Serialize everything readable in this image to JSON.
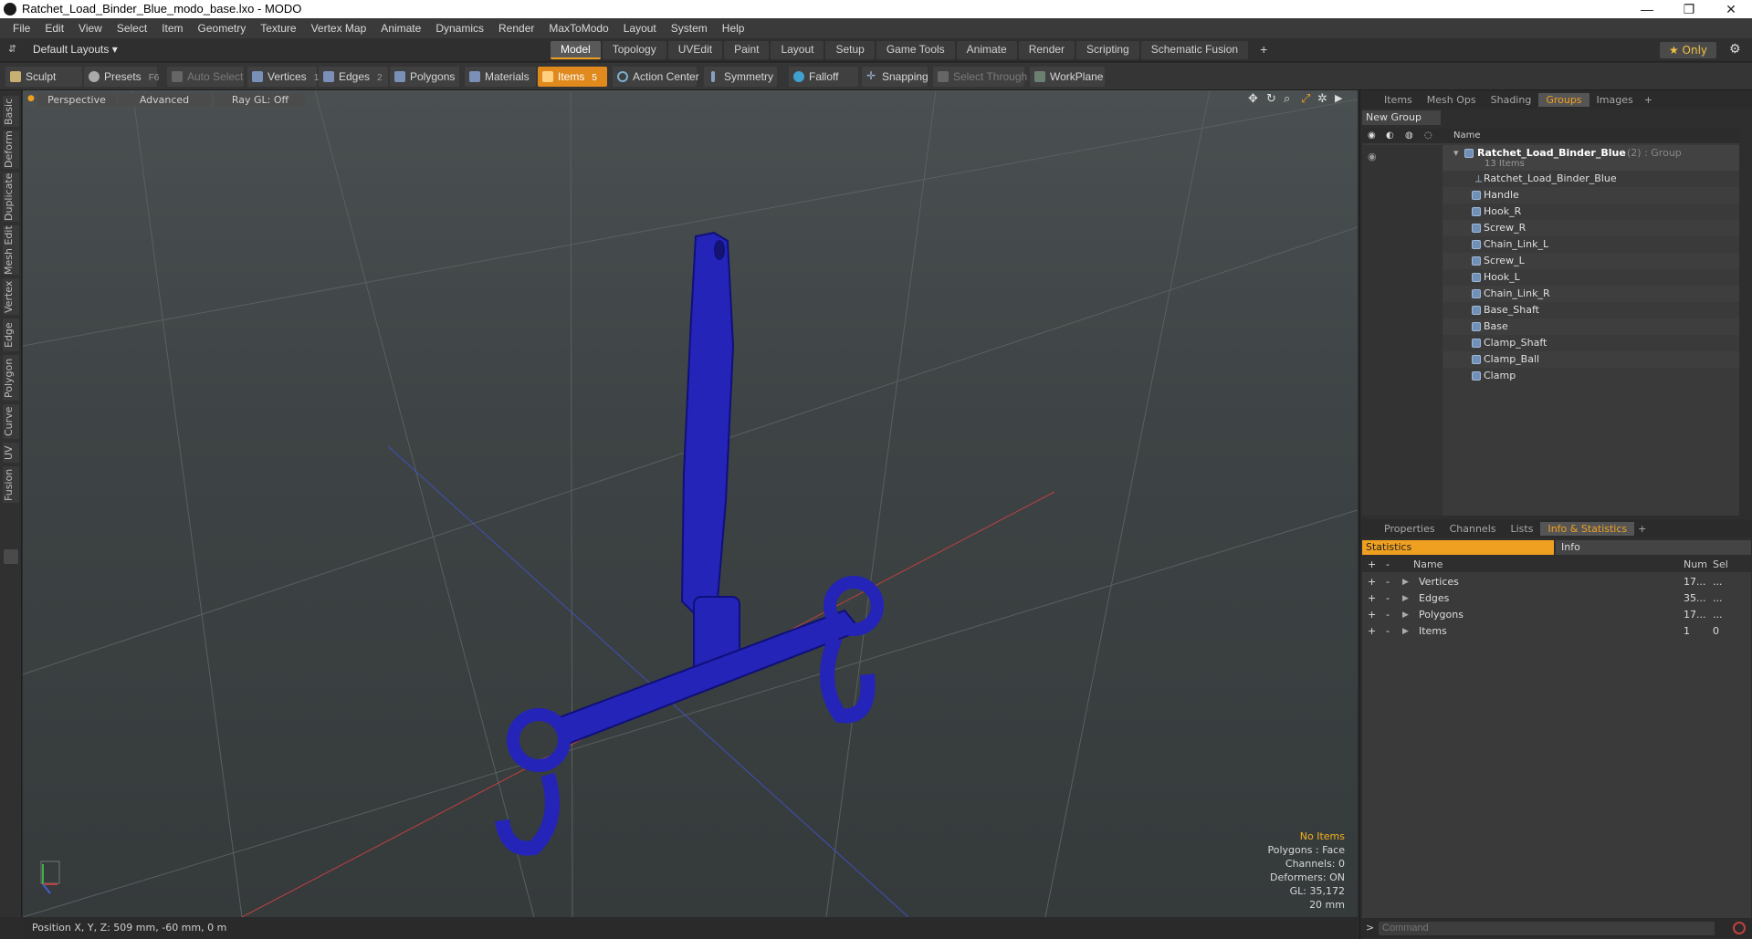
{
  "window": {
    "title": "Ratchet_Load_Binder_Blue_modo_base.lxo - MODO",
    "minimize": "—",
    "maximize": "❐",
    "close": "✕"
  },
  "menu": [
    "File",
    "Edit",
    "View",
    "Select",
    "Item",
    "Geometry",
    "Texture",
    "Vertex Map",
    "Animate",
    "Dynamics",
    "Render",
    "MaxToModo",
    "Layout",
    "System",
    "Help"
  ],
  "layout": {
    "dropdown": "Default Layouts ▾",
    "tabs": [
      "Model",
      "Topology",
      "UVEdit",
      "Paint",
      "Layout",
      "Setup",
      "Game Tools",
      "Animate",
      "Render",
      "Scripting",
      "Schematic Fusion"
    ],
    "active_tab": "Model",
    "add": "+",
    "only_label": "★ Only"
  },
  "toolbar": {
    "sculpt": "Sculpt",
    "presets": "Presets",
    "presets_key": "F6",
    "auto_select": "Auto Select",
    "vertices": "Vertices",
    "vertices_num": "1",
    "edges": "Edges",
    "edges_num": "2",
    "polygons": "Polygons",
    "materials": "Materials",
    "items": "Items",
    "items_num": "5",
    "action_center": "Action Center",
    "symmetry": "Symmetry",
    "falloff": "Falloff",
    "snapping": "Snapping",
    "select_through": "Select Through",
    "workplane": "WorkPlane"
  },
  "left_tabs": [
    "Basic",
    "Deform",
    "Duplicate",
    "Mesh Edit",
    "Vertex",
    "Edge",
    "Polygon",
    "Curve",
    "UV",
    "Fusion"
  ],
  "viewport": {
    "view_label": "Perspective",
    "shading_label": "Advanced",
    "raygl_label": "Ray GL: Off",
    "info": {
      "no_items": "No Items",
      "polygons": "Polygons : Face",
      "channels": "Channels: 0",
      "deformers": "Deformers: ON",
      "gl": "GL: 35,172",
      "scale": "20 mm"
    },
    "model_color": "#2222b8"
  },
  "status": {
    "position": "Position X, Y, Z:   509 mm, -60 mm, 0 m"
  },
  "top_panel": {
    "tabs": [
      "Items",
      "Mesh Ops",
      "Shading",
      "Groups",
      "Images"
    ],
    "active_tab": "Groups",
    "new_group": "New Group",
    "name_header": "Name",
    "group": {
      "name": "Ratchet_Load_Binder_Blue",
      "suffix": "(2) : Group",
      "count": "13 Items"
    },
    "items": [
      "Ratchet_Load_Binder_Blue",
      "Handle",
      "Hook_R",
      "Screw_R",
      "Chain_Link_L",
      "Screw_L",
      "Hook_L",
      "Chain_Link_R",
      "Base_Shaft",
      "Base",
      "Clamp_Shaft",
      "Clamp_Ball",
      "Clamp"
    ]
  },
  "bottom_panel": {
    "tabs": [
      "Properties",
      "Channels",
      "Lists",
      "Info & Statistics"
    ],
    "active_tab": "Info & Statistics",
    "statistics_label": "Statistics",
    "info_label": "Info",
    "headers": {
      "name": "Name",
      "num": "Num",
      "sel": "Sel"
    },
    "rows": [
      {
        "name": "Vertices",
        "num": "17...",
        "sel": "..."
      },
      {
        "name": "Edges",
        "num": "35...",
        "sel": "..."
      },
      {
        "name": "Polygons",
        "num": "17...",
        "sel": "..."
      },
      {
        "name": "Items",
        "num": "1",
        "sel": "0"
      }
    ]
  },
  "command": {
    "placeholder": "Command",
    "prompt": ">"
  },
  "colors": {
    "accent": "#f0a020",
    "items_active": "#e08a1e"
  }
}
